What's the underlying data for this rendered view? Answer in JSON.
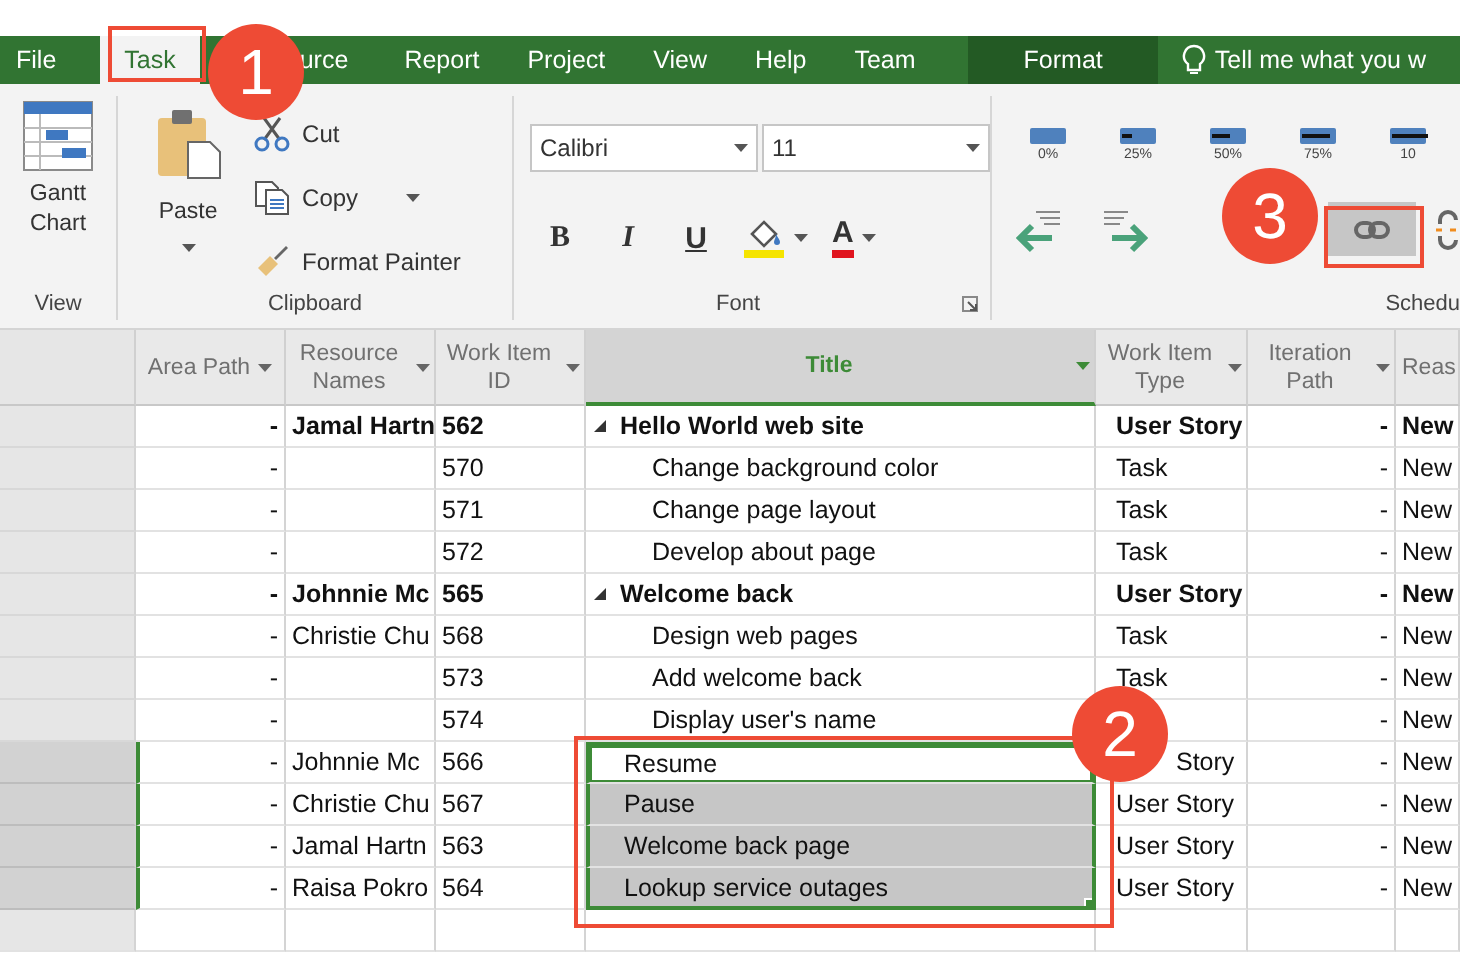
{
  "ribbon_tabs": [
    {
      "label": "File",
      "selected": false,
      "kind": "tab"
    },
    {
      "label": "Task",
      "selected": true,
      "kind": "tab"
    },
    {
      "label": "urce",
      "selected": false,
      "kind": "tab"
    },
    {
      "label": "Report",
      "selected": false,
      "kind": "tab"
    },
    {
      "label": "Project",
      "selected": false,
      "kind": "tab"
    },
    {
      "label": "View",
      "selected": false,
      "kind": "tab"
    },
    {
      "label": "Help",
      "selected": false,
      "kind": "tab"
    },
    {
      "label": "Team",
      "selected": false,
      "kind": "tab"
    },
    {
      "label": "Format",
      "selected": false,
      "kind": "contextual"
    }
  ],
  "tell_me": {
    "text": "Tell me what you w"
  },
  "view_group": {
    "gantt_label": "Gantt Chart",
    "label": "View"
  },
  "clipboard_group": {
    "paste": "Paste",
    "cut": "Cut",
    "copy": "Copy",
    "format_painter": "Format Painter",
    "label": "Clipboard"
  },
  "font_group": {
    "font_name": "Calibri",
    "font_size": "11",
    "bold": "B",
    "italic": "I",
    "underline": "U",
    "font_color": "A",
    "label": "Font"
  },
  "schedule_group": {
    "percent_buttons": [
      {
        "label": "0%",
        "level": 0
      },
      {
        "label": "25%",
        "level": 0.25
      },
      {
        "label": "50%",
        "level": 0.5
      },
      {
        "label": "75%",
        "level": 0.75
      },
      {
        "label": "10",
        "level": 1
      }
    ],
    "link_button": {
      "selected": true
    },
    "label": "Schedu"
  },
  "grid": {
    "columns": [
      {
        "label": "Area Path",
        "selected": false
      },
      {
        "label": "Resource Names",
        "selected": false
      },
      {
        "label": "Work Item ID",
        "selected": false
      },
      {
        "label": "Title",
        "selected": true
      },
      {
        "label": "Work Item Type",
        "selected": false
      },
      {
        "label": "Iteration Path",
        "selected": false
      },
      {
        "label": "Reas",
        "selected": false
      }
    ],
    "rows": [
      {
        "area": "-",
        "resource": "Jamal Hartn",
        "id": "562",
        "title": "Hello World web site",
        "type": "User Story",
        "iteration": "-",
        "reason": "New",
        "summary": true,
        "selected": false,
        "active": false,
        "children": [
          {
            "area": "-",
            "id": "570",
            "title": "Change background color",
            "type": "Task",
            "iteration": "-",
            "reason": "New",
            "summary": false,
            "selected": false,
            "active": false
          },
          {
            "area": "-",
            "id": "571",
            "title": "Change page layout",
            "type": "Task",
            "iteration": "-",
            "reason": "New",
            "summary": false,
            "selected": false,
            "active": false
          },
          {
            "area": "-",
            "id": "572",
            "title": "Develop about page",
            "type": "Task",
            "iteration": "-",
            "reason": "New",
            "summary": false,
            "selected": false,
            "active": false
          }
        ]
      },
      {
        "area": "-",
        "resource": "Johnnie Mc",
        "id": "565",
        "title": "Welcome back",
        "type": "User Story",
        "iteration": "-",
        "reason": "New",
        "summary": true,
        "selected": false,
        "active": false,
        "children": [
          {
            "area": "-",
            "resource": "Christie Chu",
            "id": "568",
            "title": "Design web pages",
            "type": "Task",
            "iteration": "-",
            "reason": "New",
            "summary": false,
            "selected": false,
            "active": false
          },
          {
            "area": "-",
            "id": "573",
            "title": "Add welcome back",
            "type": "Task",
            "iteration": "-",
            "reason": "New",
            "summary": false,
            "selected": false,
            "active": false
          },
          {
            "area": "-",
            "id": "574",
            "title": "Display user's name",
            "iteration": "-",
            "reason": "New",
            "summary": false,
            "selected": false,
            "active": false
          }
        ]
      },
      {
        "area": "-",
        "resource": "Johnnie Mc",
        "id": "566",
        "title": "Resume",
        "type": "Story",
        "type_covered": true,
        "iteration": "-",
        "reason": "New",
        "summary": false,
        "selected": true,
        "active": true
      },
      {
        "area": "-",
        "resource": "Christie Chu",
        "id": "567",
        "title": "Pause",
        "type": "User Story",
        "iteration": "-",
        "reason": "New",
        "summary": false,
        "selected": true,
        "active": false
      },
      {
        "area": "-",
        "resource": "Jamal Hartn",
        "id": "563",
        "title": "Welcome back page",
        "type": "User Story",
        "iteration": "-",
        "reason": "New",
        "summary": false,
        "selected": true,
        "active": false
      },
      {
        "area": "-",
        "resource": "Raisa Pokro",
        "id": "564",
        "title": "Lookup service outages",
        "type": "User Story",
        "iteration": "-",
        "reason": "New",
        "summary": false,
        "selected": true,
        "active": false
      }
    ]
  },
  "callouts": [
    {
      "number": "1"
    },
    {
      "number": "2"
    },
    {
      "number": "3"
    }
  ]
}
